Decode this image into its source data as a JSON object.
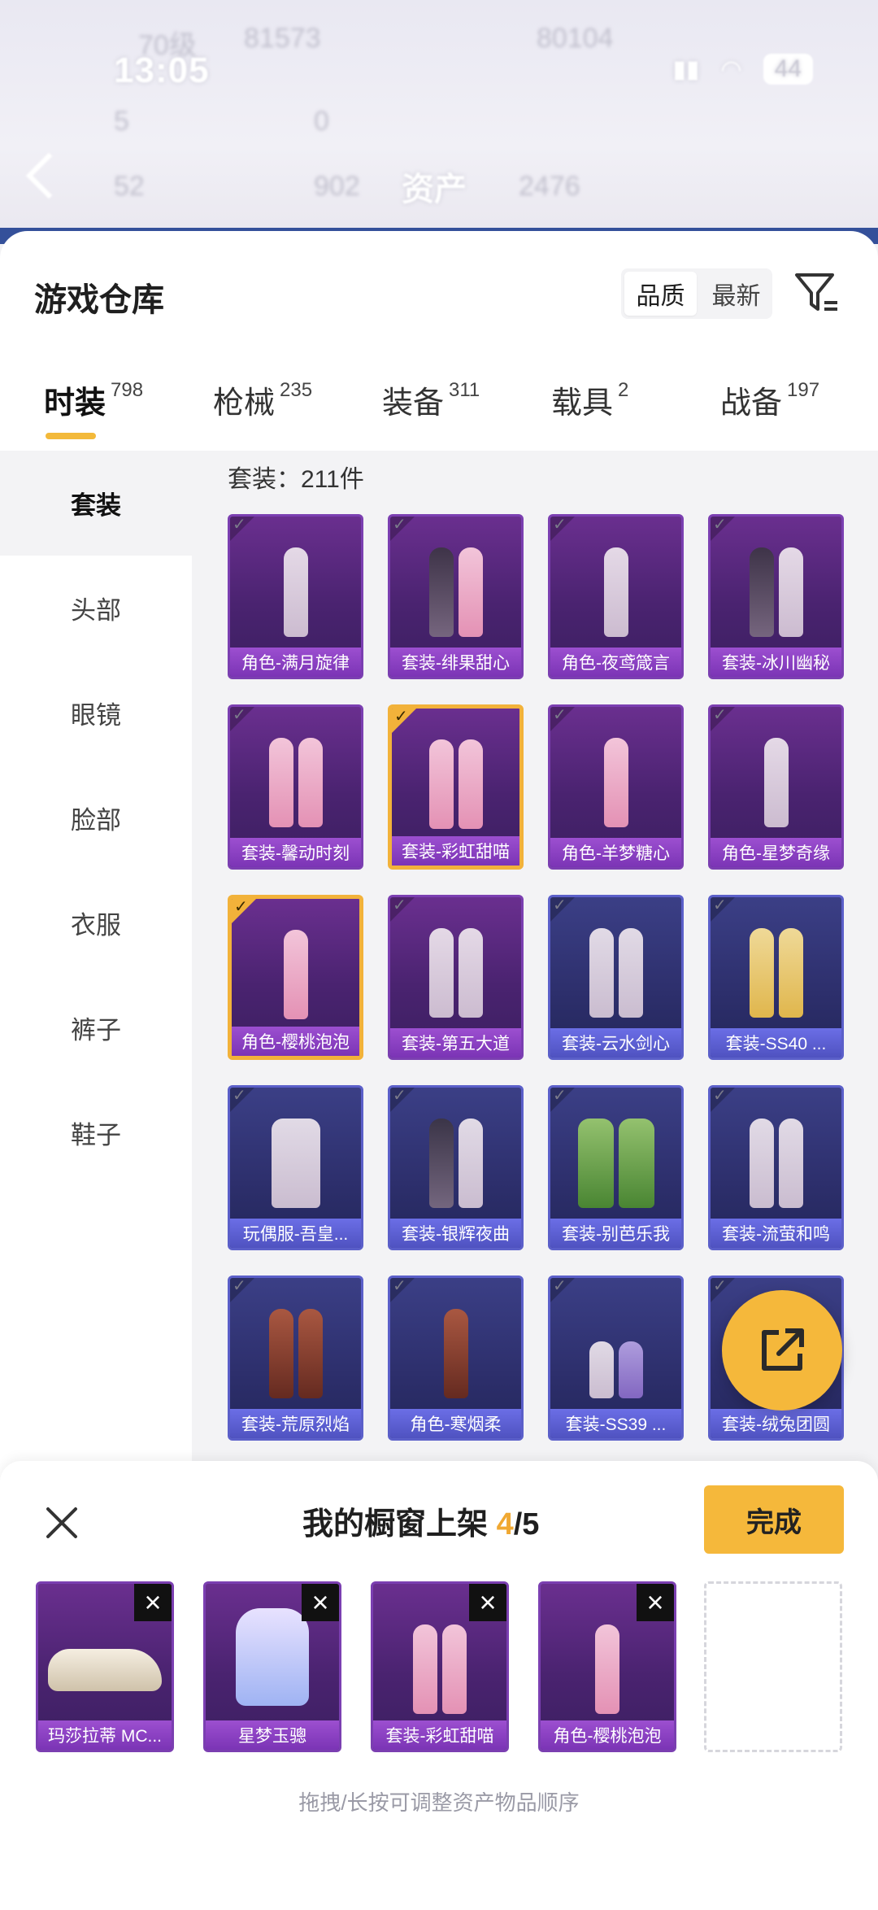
{
  "background": {
    "time": "13:05",
    "battery": "44",
    "title": "资产",
    "blurred_level": "70级",
    "blurred_id": "81573",
    "blurred_right_id": "80104",
    "blurred_counts": [
      "5",
      "0",
      "52",
      "902",
      "2476"
    ]
  },
  "sheet": {
    "title": "游戏仓库",
    "sort_options": [
      "品质",
      "最新"
    ]
  },
  "tabs": [
    {
      "label": "时装",
      "count": "798"
    },
    {
      "label": "枪械",
      "count": "235"
    },
    {
      "label": "装备",
      "count": "311"
    },
    {
      "label": "载具",
      "count": "2"
    },
    {
      "label": "战备",
      "count": "197"
    }
  ],
  "categories": [
    "套装",
    "头部",
    "眼镜",
    "脸部",
    "衣服",
    "裤子",
    "鞋子"
  ],
  "grid": {
    "header": "套装：211件",
    "items": [
      "角色-满月旋律",
      "套装-绯果甜心",
      "角色-夜鸢箴言",
      "套装-冰川幽秘",
      "套装-馨动时刻",
      "套装-彩虹甜喵",
      "角色-羊梦糖心",
      "角色-星梦奇缘",
      "角色-樱桃泡泡",
      "套装-第五大道",
      "套装-云水剑心",
      "套装-SS40 ...",
      "玩偶服-吾皇...",
      "套装-银辉夜曲",
      "套装-别芭乐我",
      "套装-流萤和鸣",
      "套装-荒原烈焰",
      "角色-寒烟柔",
      "套装-SS39 ...",
      "套装-绒兔团圆"
    ]
  },
  "showcase": {
    "title_prefix": "我的橱窗上架 ",
    "count_current": "4",
    "count_total": "/5",
    "done_label": "完成",
    "slots": [
      "玛莎拉蒂 MC...",
      "星梦玉骢",
      "套装-彩虹甜喵",
      "角色-樱桃泡泡"
    ],
    "hint": "拖拽/长按可调整资产物品顺序"
  },
  "colors": {
    "accent": "#f5b83b",
    "card_purple": "#7b3fb1",
    "card_blue": "#5b5fc9"
  }
}
